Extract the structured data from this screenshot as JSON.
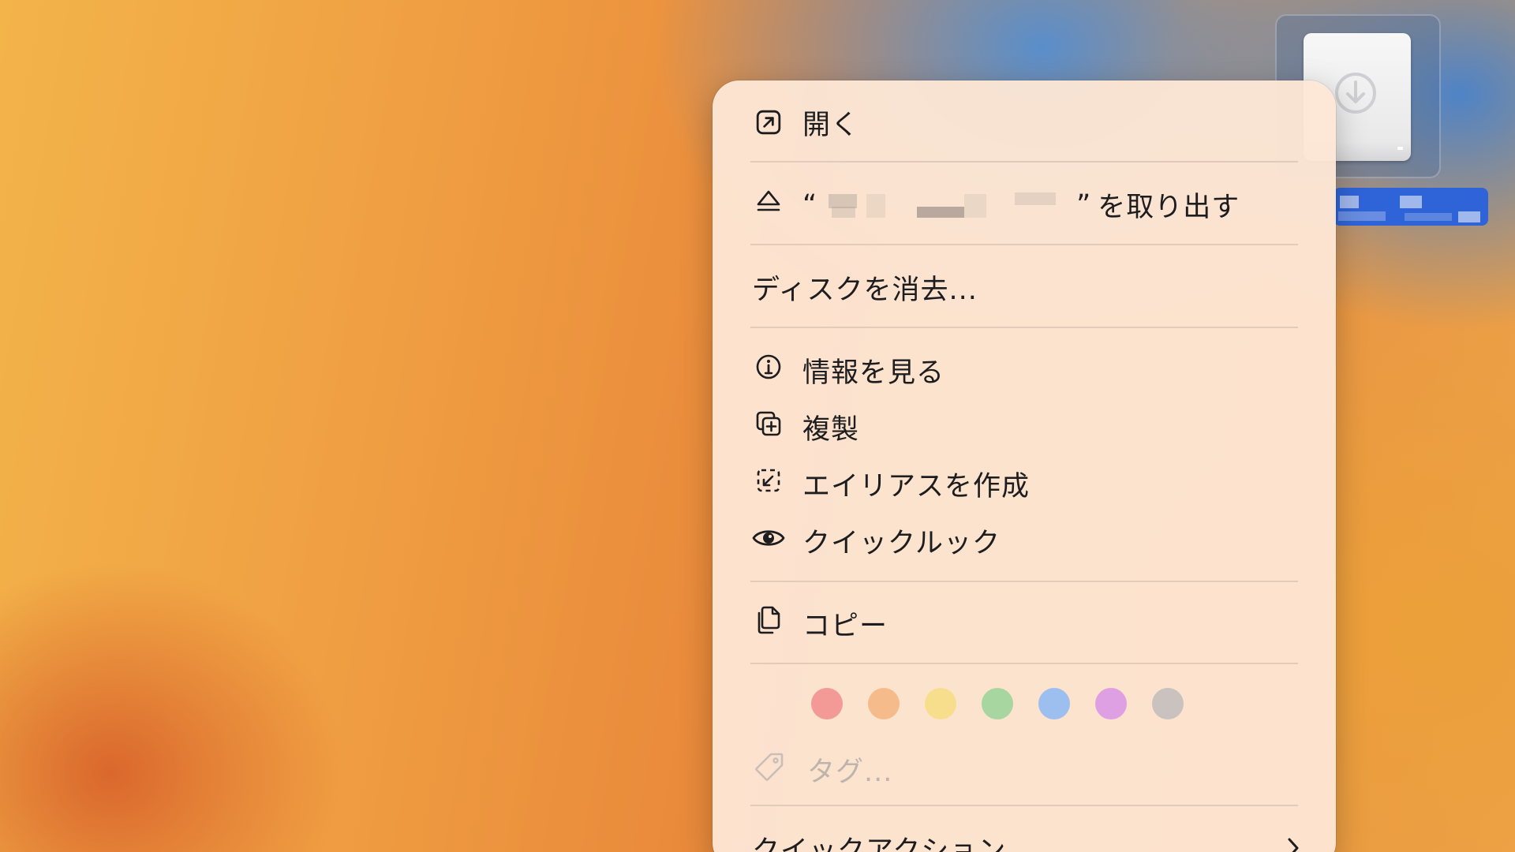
{
  "menu": {
    "open": {
      "label": "開く",
      "icon": "open-icon"
    },
    "eject": {
      "quote_open": "“",
      "quote_close": "”",
      "suffix": "を取り出す",
      "icon": "eject-icon"
    },
    "erase": {
      "label": "ディスクを消去..."
    },
    "get_info": {
      "label": "情報を見る",
      "icon": "info-icon"
    },
    "duplicate": {
      "label": "複製",
      "icon": "duplicate-icon"
    },
    "make_alias": {
      "label": "エイリアスを作成",
      "icon": "alias-icon"
    },
    "quick_look": {
      "label": "クイックルック",
      "icon": "eye-icon"
    },
    "copy": {
      "label": "コピー",
      "icon": "copy-icon"
    },
    "tags": {
      "colors": [
        {
          "name": "red",
          "hex": "#f39a96"
        },
        {
          "name": "orange",
          "hex": "#f6bb8a"
        },
        {
          "name": "yellow",
          "hex": "#f7de8c"
        },
        {
          "name": "green",
          "hex": "#a7d6a0"
        },
        {
          "name": "blue",
          "hex": "#9cbff0"
        },
        {
          "name": "purple",
          "hex": "#dea0e2"
        },
        {
          "name": "gray",
          "hex": "#c9c2bf"
        }
      ],
      "label": "タグ...",
      "icon": "tag-icon"
    },
    "quick_actions": {
      "label": "クイックアクション",
      "icon": "chevron-right-icon"
    }
  },
  "desktop": {
    "drive_icon": "external-drive-icon",
    "selection_color": "#2f63d8"
  }
}
